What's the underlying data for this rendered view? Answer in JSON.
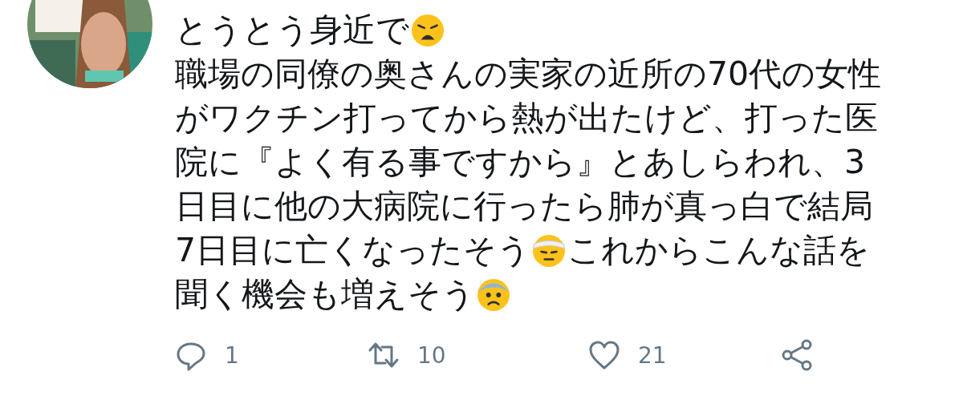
{
  "tweet": {
    "avatar": {
      "kind": "picture"
    },
    "lines": [
      [
        {
          "kind": "text",
          "text": "とうとう身近で"
        },
        {
          "kind": "weary-face"
        }
      ],
      [
        {
          "kind": "text",
          "text": "職場の同僚の奥さんの実家の近所の70代の女性"
        }
      ],
      [
        {
          "kind": "text",
          "text": "がワクチン打ってから熱が出たけど、打った医"
        }
      ],
      [
        {
          "kind": "text",
          "text": "院に『よく有る事ですから』とあしらわれ、3"
        }
      ],
      [
        {
          "kind": "text",
          "text": "日目に他の大病院に行ったら肺が真っ白で結局"
        }
      ],
      [
        {
          "kind": "text",
          "text": "7日目に亡くなったそう"
        },
        {
          "kind": "bandaged-face"
        },
        {
          "kind": "text",
          "text": "これからこんな話を"
        }
      ],
      [
        {
          "kind": "text",
          "text": "聞く機会も増えそう"
        },
        {
          "kind": "anxious-face"
        }
      ]
    ],
    "actions": [
      {
        "kind": "reply",
        "count": "1"
      },
      {
        "kind": "retweet",
        "count": "10"
      },
      {
        "kind": "like",
        "count": "21"
      },
      {
        "kind": "share"
      }
    ]
  }
}
